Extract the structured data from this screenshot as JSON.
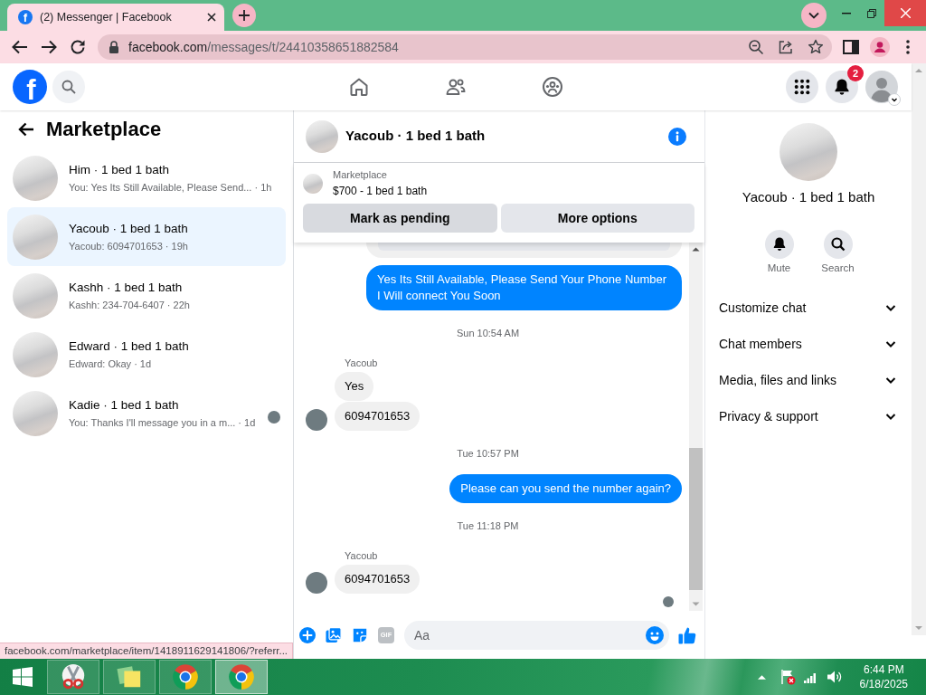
{
  "browser": {
    "tabs": [
      {
        "favicon": "f",
        "title": "(2) Messenger | Facebook",
        "selected": true
      }
    ],
    "url": {
      "host": "facebook.com",
      "path": "/messages/t/24410358651882584"
    },
    "status_link": "facebook.com/marketplace/item/1418911629141806/?referr..."
  },
  "header": {
    "logo": "f",
    "notifications": "2"
  },
  "sidebar": {
    "title": "Marketplace",
    "conversations": [
      {
        "name": "Him · 1 bed 1 bath",
        "preview": "You: Yes Its Still Available, Please Send... · 1h",
        "selected": false,
        "read_receipt": false
      },
      {
        "name": "Yacoub · 1 bed 1 bath",
        "preview": "Yacoub: 6094701653 · 19h",
        "selected": true,
        "read_receipt": false
      },
      {
        "name": "Kashh · 1 bed 1 bath",
        "preview": "Kashh: 234-704-6407 · 22h",
        "selected": false,
        "read_receipt": false
      },
      {
        "name": "Edward · 1 bed 1 bath",
        "preview": "Edward: Okay · 1d",
        "selected": false,
        "read_receipt": false
      },
      {
        "name": "Kadie · 1 bed 1 bath",
        "preview": "You: Thanks I'll message you in a m... · 1d",
        "selected": false,
        "read_receipt": true
      }
    ]
  },
  "chat": {
    "title": "Yacoub · 1 bed 1 bath",
    "listing": {
      "label": "Marketplace",
      "title": "$700 - 1 bed 1 bath",
      "buttons": [
        {
          "label": "Mark as pending",
          "highlighted": true
        },
        {
          "label": "More options",
          "highlighted": false
        }
      ]
    },
    "messages": [
      {
        "kind": "attachment"
      },
      {
        "kind": "outgoing",
        "text": "Yes Its Still Available, Please Send Your Phone Number I Will connect You Soon"
      },
      {
        "kind": "timestamp",
        "text": "Sun 10:54 AM"
      },
      {
        "kind": "sender",
        "text": "Yacoub"
      },
      {
        "kind": "incoming",
        "text": "Yes",
        "avatar": false
      },
      {
        "kind": "incoming",
        "text": "6094701653",
        "avatar": true
      },
      {
        "kind": "timestamp",
        "text": "Tue 10:57 PM"
      },
      {
        "kind": "outgoing",
        "text": "Please can you send the number again?"
      },
      {
        "kind": "timestamp",
        "text": "Tue 11:18 PM"
      },
      {
        "kind": "sender",
        "text": "Yacoub"
      },
      {
        "kind": "incoming",
        "text": "6094701653",
        "avatar": true
      },
      {
        "kind": "seen"
      }
    ],
    "composer": {
      "gif": "GIF",
      "placeholder": "Aa"
    }
  },
  "details": {
    "name": "Yacoub · 1 bed 1 bath",
    "actions": [
      {
        "kind": "mute",
        "label": "Mute"
      },
      {
        "kind": "search",
        "label": "Search"
      }
    ],
    "sections": [
      {
        "label": "Customize chat",
        "expanded": false
      },
      {
        "label": "Chat members",
        "expanded": false
      },
      {
        "label": "Media, files and links",
        "expanded": false
      },
      {
        "label": "Privacy & support",
        "expanded": false
      }
    ]
  },
  "taskbar": {
    "apps": [
      {
        "kind": "scissors",
        "selected": false
      },
      {
        "kind": "notes",
        "selected": false
      },
      {
        "kind": "browser",
        "selected": false
      },
      {
        "kind": "browser",
        "selected": true
      }
    ],
    "time": "6:44 PM",
    "date": "6/18/2025"
  }
}
